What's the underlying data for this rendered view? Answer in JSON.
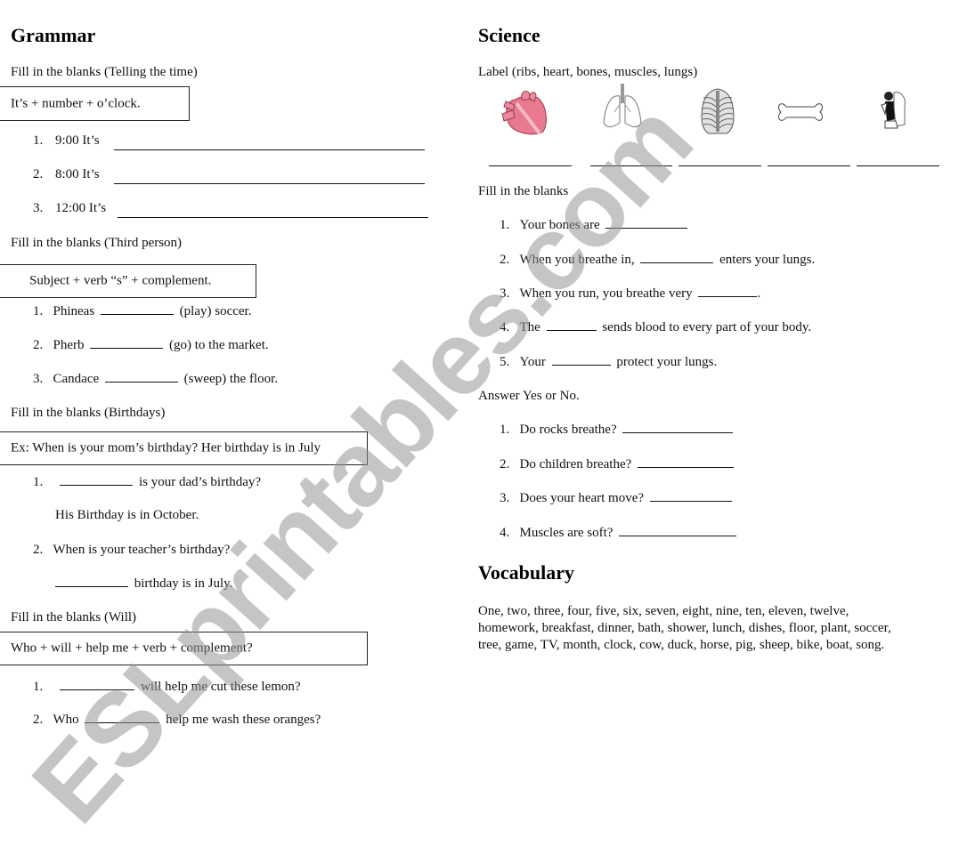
{
  "grammar": {
    "title": "Grammar",
    "telling_time": {
      "instruction": "Fill in the blanks (Telling the time)",
      "rule": "It’s + number + o’clock.",
      "items": [
        {
          "num": "1.",
          "text": "9:00  It’s"
        },
        {
          "num": "2.",
          "text": "8:00  It’s"
        },
        {
          "num": "3.",
          "text": "12:00 It’s"
        }
      ]
    },
    "third_person": {
      "instruction": "Fill in the blanks (Third person)",
      "rule": "Subject + verb “s” + complement.",
      "items": [
        {
          "num": "1.",
          "before": "Phineas",
          "after": "(play) soccer."
        },
        {
          "num": "2.",
          "before": "Pherb",
          "after": "(go) to the market."
        },
        {
          "num": "3.",
          "before": "Candace",
          "after": "(sweep) the floor."
        }
      ]
    },
    "birthdays": {
      "instruction": "Fill in the blanks (Birthdays)",
      "example": "Ex: When is your mom’s birthday? Her birthday is in July",
      "items": [
        {
          "num": "1.",
          "after": "is your dad’s birthday?",
          "answer_line": "His Birthday is in October."
        },
        {
          "num": "2.",
          "question": "When is your teacher’s birthday?",
          "after": "birthday is in July."
        }
      ]
    },
    "will": {
      "instruction": "Fill in the blanks (Will)",
      "rule": "Who + will + help me + verb + complement?",
      "items": [
        {
          "num": "1.",
          "before": "",
          "after": "will help me cut these lemon?"
        },
        {
          "num": "2.",
          "before": "Who",
          "after": "help me wash these oranges?"
        }
      ]
    }
  },
  "science": {
    "title": "Science",
    "label_instruction": "Label (ribs, heart, bones, muscles, lungs)",
    "pictures": [
      "heart-picture",
      "lungs-picture",
      "ribs-picture",
      "bone-picture",
      "muscles-picture"
    ],
    "fill_instruction": "Fill in the blanks",
    "fill_items": [
      {
        "num": "1.",
        "before": "Your bones are",
        "after": ""
      },
      {
        "num": "2.",
        "before": "When you breathe in,",
        "after": "enters your lungs."
      },
      {
        "num": "3.",
        "before": "When you run, you breathe very",
        "after": "."
      },
      {
        "num": "4.",
        "before": "The",
        "after": "sends blood to every part of your body."
      },
      {
        "num": "5.",
        "before": "Your",
        "after": "protect your lungs."
      }
    ],
    "yesno_instruction": "Answer Yes or No.",
    "yesno_items": [
      {
        "num": "1.",
        "text": "Do rocks breathe?"
      },
      {
        "num": "2.",
        "text": "Do children breathe?"
      },
      {
        "num": "3.",
        "text": "Does your heart move?"
      },
      {
        "num": "4.",
        "text": "Muscles are soft?"
      }
    ]
  },
  "vocabulary": {
    "title": "Vocabulary",
    "lines": [
      "One, two, three, four, five, six, seven, eight, nine, ten, eleven, twelve,",
      "homework, breakfast, dinner, bath, shower, lunch, dishes, floor, plant, soccer,",
      "tree, game, TV, month, clock, cow, duck, horse, pig, sheep, bike, boat, song."
    ]
  },
  "watermark": "ESLprintables.com"
}
